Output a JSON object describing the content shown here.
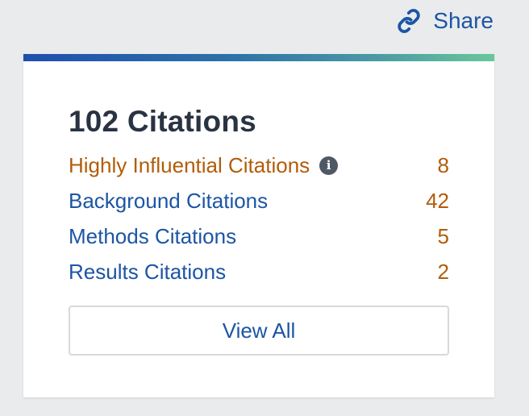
{
  "share": {
    "label": "Share",
    "icon": "link-icon"
  },
  "card": {
    "accent_gradient": [
      "#1f4fad",
      "#68c79a"
    ],
    "title": "102 Citations",
    "rows": [
      {
        "label": "Highly Influential Citations",
        "count": "8",
        "color": "#b25c08",
        "has_info": true,
        "info_icon": "info-icon"
      },
      {
        "label": "Background Citations",
        "count": "42",
        "color": "#1c55a5"
      },
      {
        "label": "Methods Citations",
        "count": "5",
        "color": "#1c55a5"
      },
      {
        "label": "Results Citations",
        "count": "2",
        "color": "#1c55a5"
      }
    ],
    "view_all_label": "View All"
  }
}
